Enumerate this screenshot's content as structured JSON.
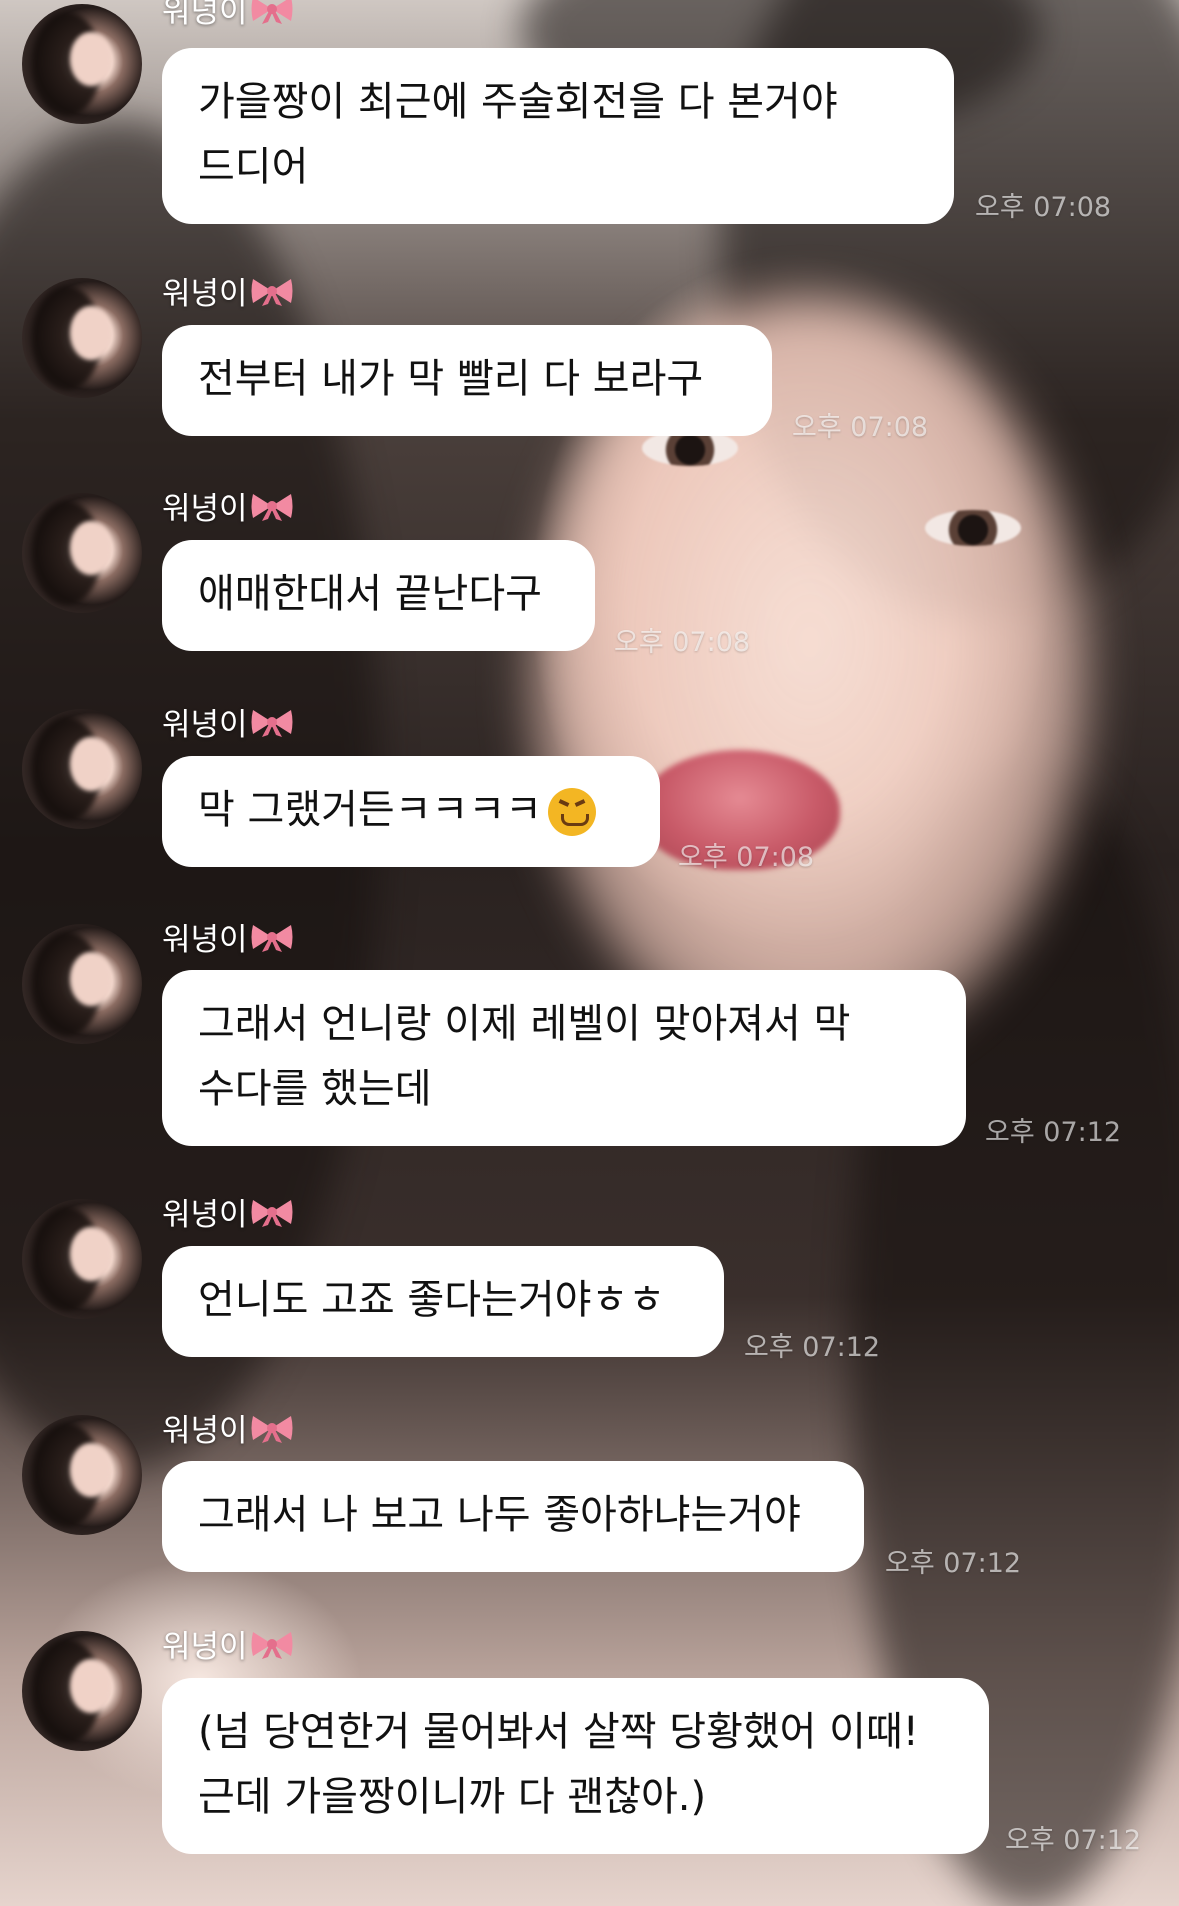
{
  "chat": {
    "messages": [
      {
        "sender": "워녕이",
        "sender_icon": "ribbon-icon",
        "text": "가을짱이 최근에 주술회전을 다 본거야 드디어",
        "time": "오후 07:08"
      },
      {
        "sender": "워녕이",
        "sender_icon": "ribbon-icon",
        "text": "전부터 내가 막 빨리 다 보라구",
        "time": "오후 07:08"
      },
      {
        "sender": "워녕이",
        "sender_icon": "ribbon-icon",
        "text": "애매한대서 끝난다구",
        "time": "오후 07:08"
      },
      {
        "sender": "워녕이",
        "sender_icon": "ribbon-icon",
        "text": "막 그랬거든ㅋㅋㅋㅋ",
        "emoji": "confounded-face",
        "time": "오후 07:08"
      },
      {
        "sender": "워녕이",
        "sender_icon": "ribbon-icon",
        "text": "그래서 언니랑 이제 레벨이 맞아져서 막 수다를 했는데",
        "time": "오후 07:12"
      },
      {
        "sender": "워녕이",
        "sender_icon": "ribbon-icon",
        "text": "언니도 고죠 좋다는거야ㅎㅎ",
        "time": "오후 07:12"
      },
      {
        "sender": "워녕이",
        "sender_icon": "ribbon-icon",
        "text": "그래서 나 보고 나두 좋아하냐는거야",
        "time": "오후 07:12"
      },
      {
        "sender": "워녕이",
        "sender_icon": "ribbon-icon",
        "text": "(넘 당연한거 물어봐서 살짝 당황했어 이때! 근데 가을짱이니까 다 괜찮아.)",
        "time": "오후 07:12"
      }
    ]
  },
  "colors": {
    "bubble": "#ffffff",
    "text": "#111111",
    "sender_text": "#ffffff",
    "timestamp": "rgba(255,255,255,0.62)",
    "bow": "#f28aa2"
  }
}
